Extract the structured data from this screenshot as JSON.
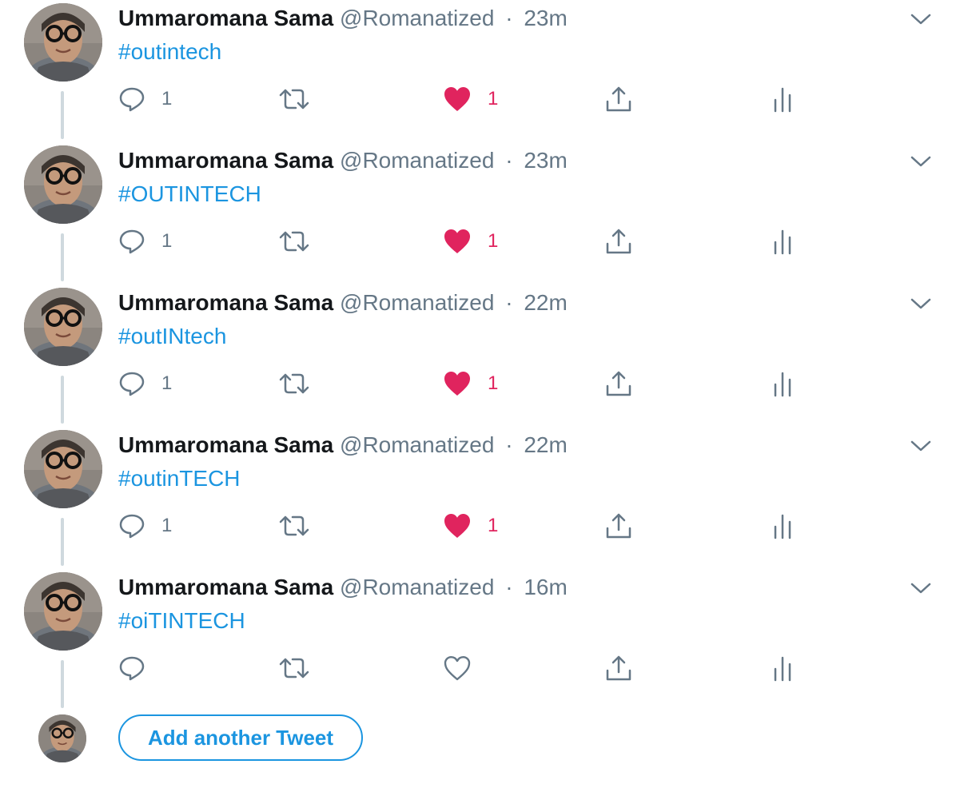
{
  "colors": {
    "accent": "#1b95e0",
    "like_active": "#e0245e",
    "muted_text": "#657786",
    "thread_line": "#cfd9de"
  },
  "tweets": [
    {
      "name": "Ummaromana Sama",
      "handle": "@Romanatized",
      "separator": "·",
      "time": "23m",
      "text": "#outintech",
      "reply_count": "1",
      "like_count": "1",
      "liked": true
    },
    {
      "name": "Ummaromana Sama",
      "handle": "@Romanatized",
      "separator": "·",
      "time": "23m",
      "text": "#OUTINTECH",
      "reply_count": "1",
      "like_count": "1",
      "liked": true
    },
    {
      "name": "Ummaromana Sama",
      "handle": "@Romanatized",
      "separator": "·",
      "time": "22m",
      "text": "#outINtech",
      "reply_count": "1",
      "like_count": "1",
      "liked": true
    },
    {
      "name": "Ummaromana Sama",
      "handle": "@Romanatized",
      "separator": "·",
      "time": "22m",
      "text": "#outinTECH",
      "reply_count": "1",
      "like_count": "1",
      "liked": true
    },
    {
      "name": "Ummaromana Sama",
      "handle": "@Romanatized",
      "separator": "·",
      "time": "16m",
      "text": "#oiTINTECH",
      "reply_count": "",
      "like_count": "",
      "liked": false
    }
  ],
  "icons": {
    "reply": "reply-icon",
    "retweet": "retweet-icon",
    "like": "heart-icon",
    "share": "share-icon",
    "analytics": "analytics-icon",
    "caret": "chevron-down-icon"
  },
  "compose": {
    "button_label": "Add another Tweet"
  }
}
